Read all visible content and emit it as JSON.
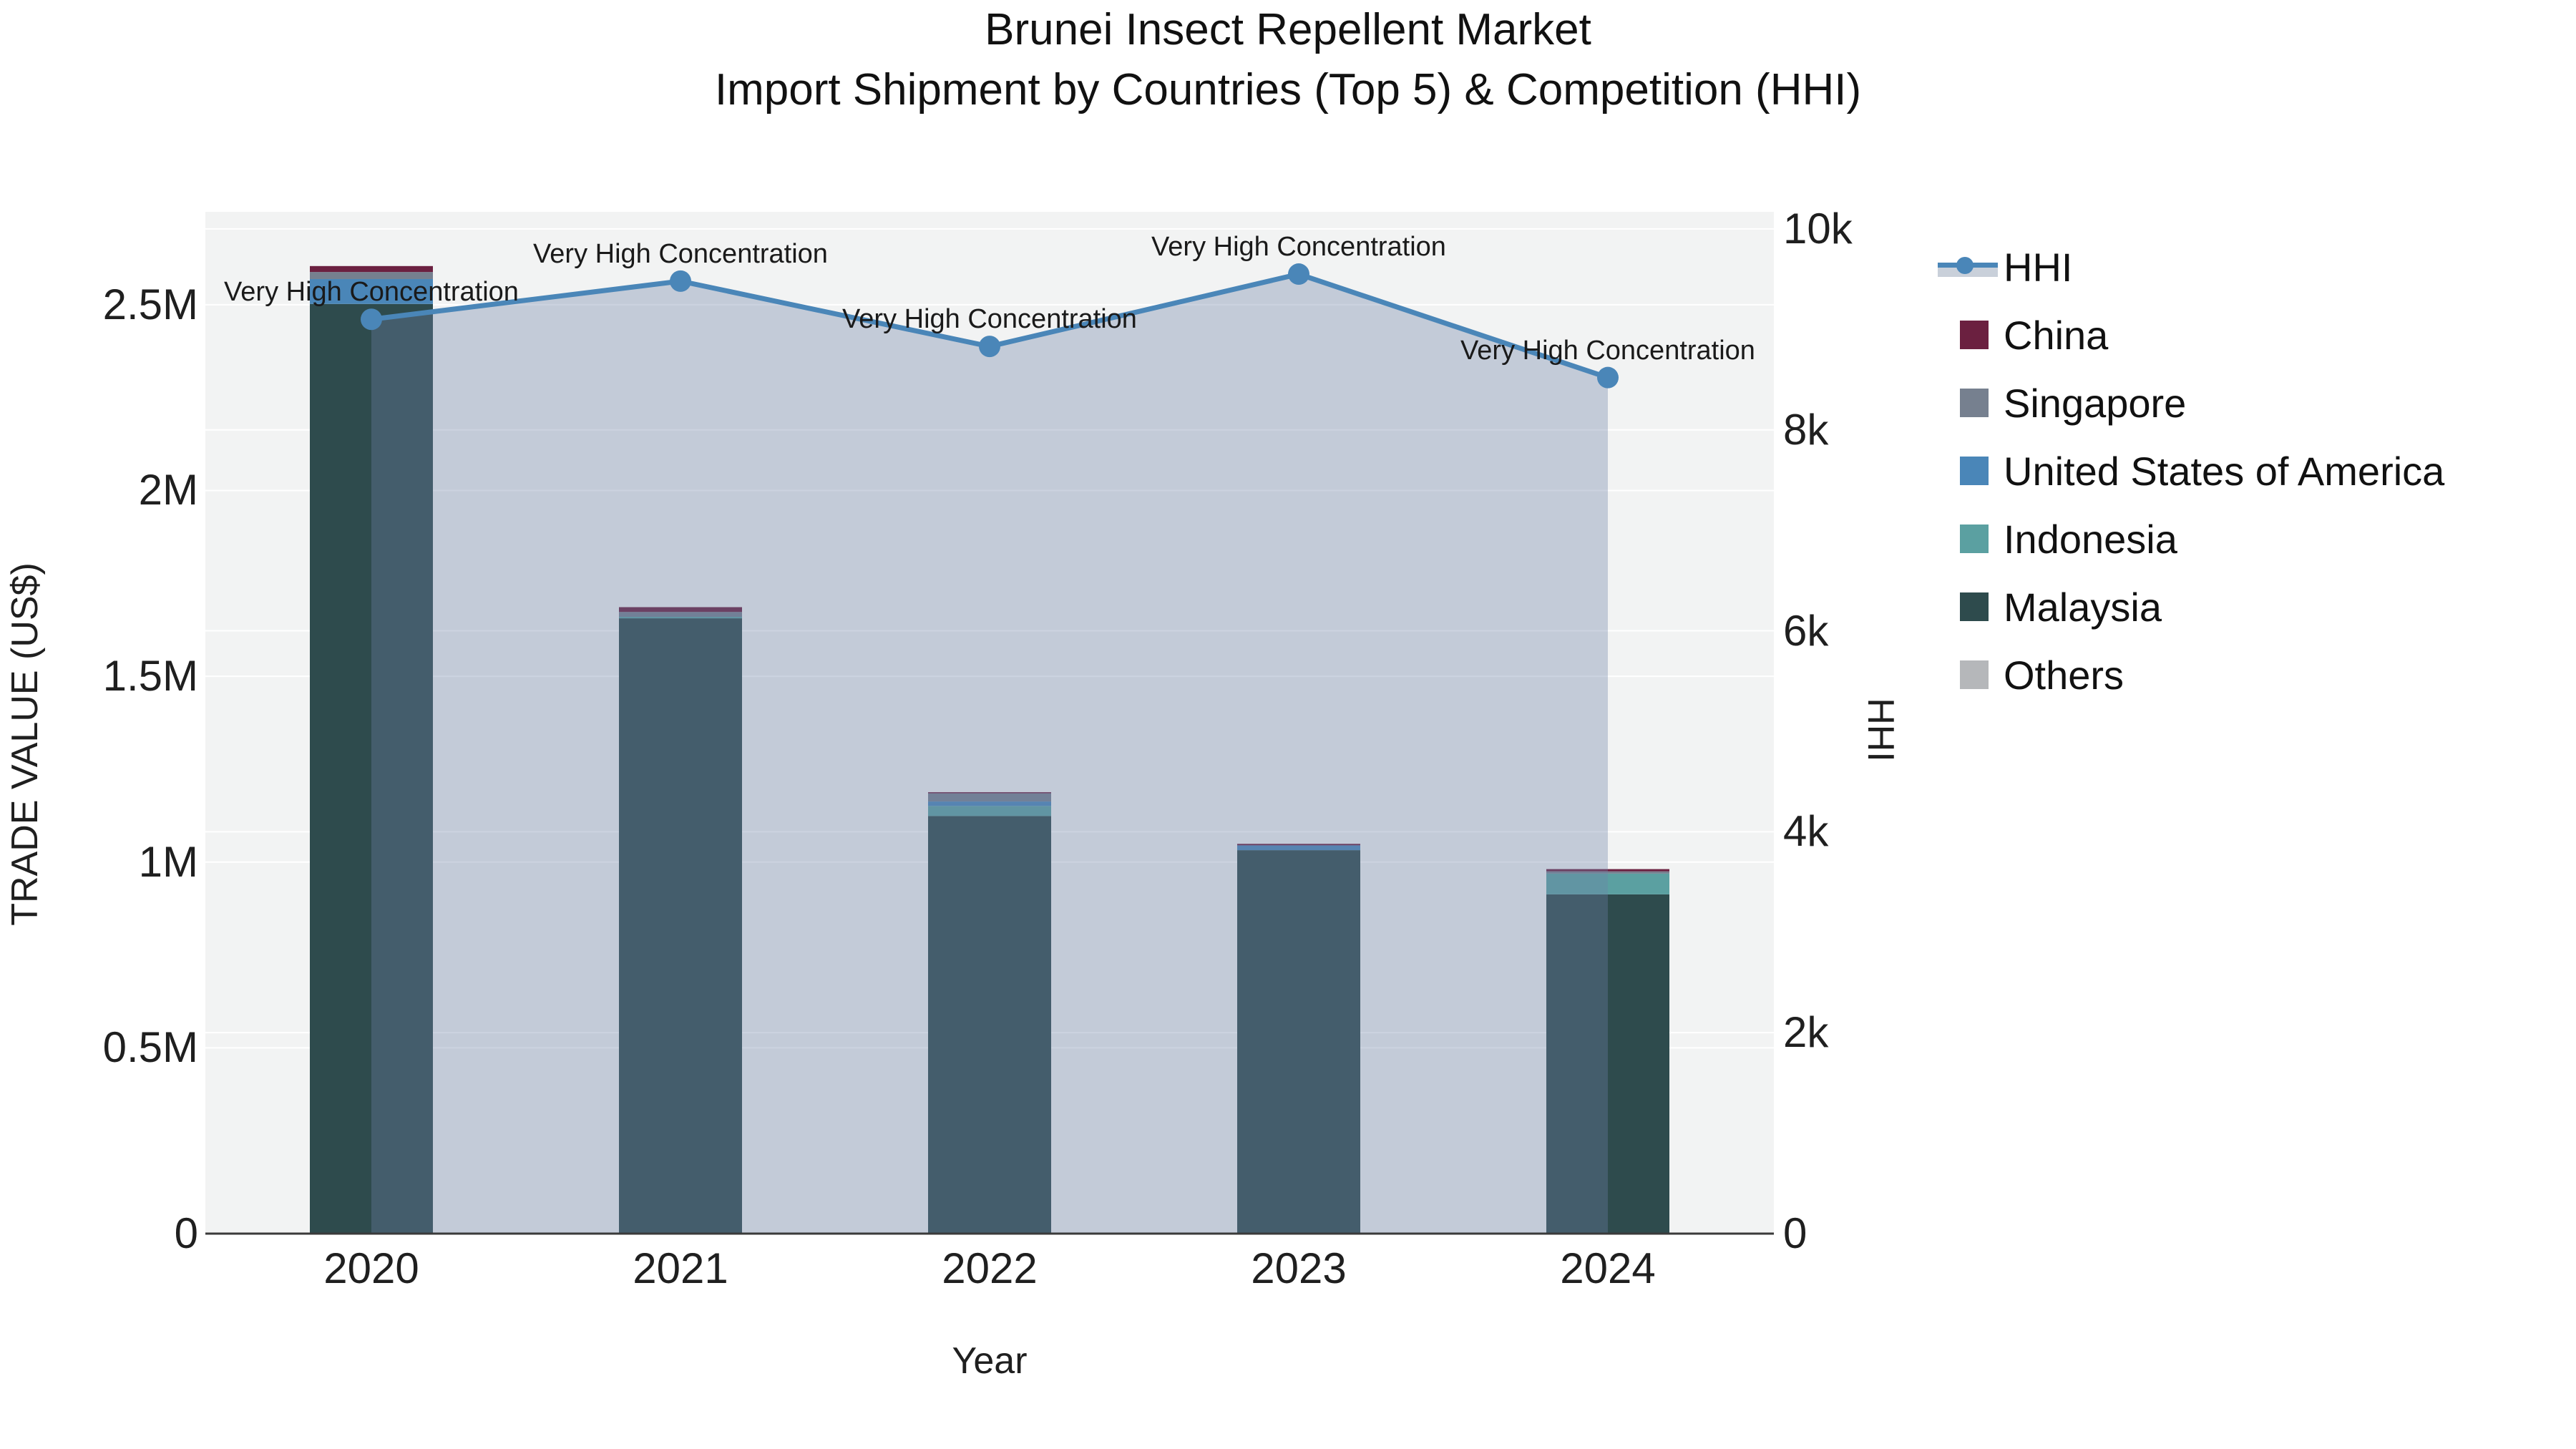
{
  "title": {
    "line1": "Brunei Insect Repellent Market",
    "line2": "Import Shipment by Countries (Top 5) & Competition (HHI)"
  },
  "axes": {
    "x": {
      "title": "Year",
      "categories": [
        "2020",
        "2021",
        "2022",
        "2023",
        "2024"
      ]
    },
    "y_left": {
      "title": "TRADE VALUE (US$)",
      "ticks": [
        {
          "value": 0,
          "label": "0"
        },
        {
          "value": 0.5,
          "label": "0.5M"
        },
        {
          "value": 1,
          "label": "1M"
        },
        {
          "value": 1.5,
          "label": "1.5M"
        },
        {
          "value": 2,
          "label": "2M"
        },
        {
          "value": 2.5,
          "label": "2.5M"
        }
      ]
    },
    "y_right": {
      "title": "HHI",
      "ticks": [
        {
          "value": 0,
          "label": "0"
        },
        {
          "value": 2000,
          "label": "2k"
        },
        {
          "value": 4000,
          "label": "4k"
        },
        {
          "value": 6000,
          "label": "6k"
        },
        {
          "value": 8000,
          "label": "8k"
        },
        {
          "value": 10000,
          "label": "10k"
        }
      ]
    }
  },
  "legend": {
    "items": [
      {
        "label": "HHI",
        "type": "line",
        "color": "#4a86b8",
        "band": "#c9d0da"
      },
      {
        "label": "China",
        "type": "swatch",
        "color": "#6b2040"
      },
      {
        "label": "Singapore",
        "type": "swatch",
        "color": "#76808f"
      },
      {
        "label": "United States of America",
        "type": "swatch",
        "color": "#4a86b8"
      },
      {
        "label": "Indonesia",
        "type": "swatch",
        "color": "#5ba0a1"
      },
      {
        "label": "Malaysia",
        "type": "swatch",
        "color": "#2e4b4d"
      },
      {
        "label": "Others",
        "type": "swatch",
        "color": "#b5b7ba"
      }
    ]
  },
  "chart_data": {
    "type": "bar",
    "subtype": "stacked-bars-with-line",
    "title": "Brunei Insect Repellent Market — Import Shipment by Countries (Top 5) & Competition (HHI)",
    "xlabel": "Year",
    "ylabel_left": "TRADE VALUE (US$)",
    "ylabel_right": "HHI",
    "categories": [
      "2020",
      "2021",
      "2022",
      "2023",
      "2024"
    ],
    "values_unit": "US$ millions",
    "series": [
      {
        "name": "China",
        "color": "#6b2040",
        "values": [
          0.016,
          0.013,
          0.003,
          0.004,
          0.006
        ]
      },
      {
        "name": "Singapore",
        "color": "#76808f",
        "values": [
          0.019,
          0.013,
          0.022,
          0.0,
          0.006
        ]
      },
      {
        "name": "United States of America",
        "color": "#4a86b8",
        "values": [
          0.067,
          0.0,
          0.012,
          0.013,
          0.0
        ]
      },
      {
        "name": "Indonesia",
        "color": "#5ba0a1",
        "values": [
          0.0,
          0.004,
          0.027,
          0.0,
          0.056
        ]
      },
      {
        "name": "Malaysia",
        "color": "#2e4b4d",
        "values": [
          2.502,
          1.656,
          1.124,
          1.032,
          0.913
        ]
      },
      {
        "name": "Others",
        "color": "#b5b7ba",
        "values": [
          0.0,
          0.0,
          0.0,
          0.0,
          0.0
        ]
      }
    ],
    "stack_order_bottom_to_top": [
      "Malaysia",
      "Indonesia",
      "United States of America",
      "Singapore",
      "China",
      "Others"
    ],
    "line_series": {
      "name": "HHI",
      "axis": "right",
      "color": "#4a86b8",
      "fill_color": "rgba(108,130,165,0.35)",
      "values": [
        9100,
        9480,
        8830,
        9550,
        8520
      ]
    },
    "ylim_left": [
      0,
      2.75
    ],
    "ylim_right": [
      0,
      10170
    ],
    "grid": true,
    "legend_position": "right",
    "annotations": [
      {
        "year": "2020",
        "text": "Very High Concentration"
      },
      {
        "year": "2021",
        "text": "Very High Concentration"
      },
      {
        "year": "2022",
        "text": "Very High Concentration"
      },
      {
        "year": "2023",
        "text": "Very High Concentration"
      },
      {
        "year": "2024",
        "text": "Very High Concentration"
      }
    ],
    "colors": {
      "plot_background": "#f2f3f3",
      "gridline": "#ffffff",
      "baseline": "#3a3a3a"
    }
  }
}
